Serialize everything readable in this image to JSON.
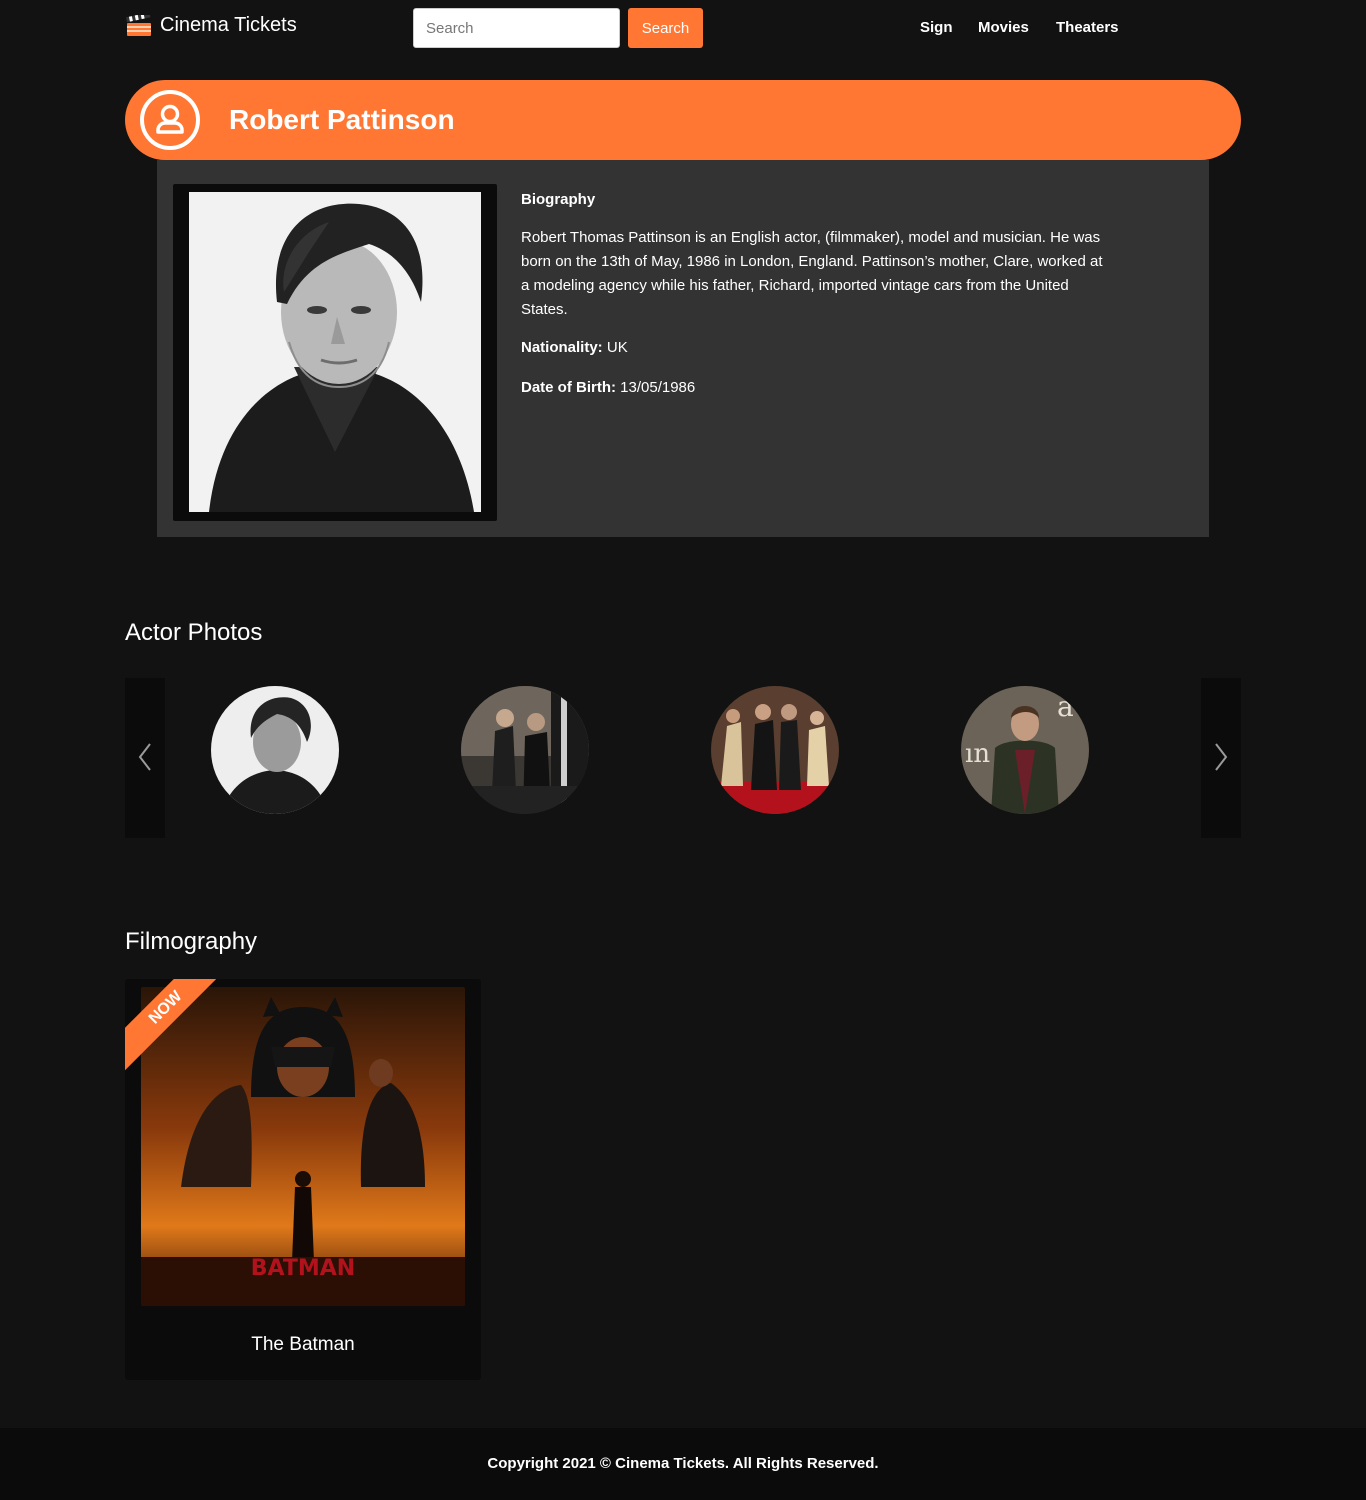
{
  "header": {
    "brand": "Cinema Tickets",
    "search_placeholder": "Search",
    "search_button": "Search",
    "nav": [
      "Sign",
      "Movies",
      "Theaters"
    ]
  },
  "actor": {
    "name": "Robert Pattinson",
    "biography_heading": "Biography",
    "biography": "Robert Thomas Pattinson is an English actor, (filmmaker), model and musician. He was born on the 13th of May, 1986 in London, England. Pattinson’s mother, Clare, worked at a modeling agency while his father, Richard, imported vintage cars from the United States.",
    "nationality_label": "Nationality:",
    "nationality": "UK",
    "dob_label": "Date of Birth:",
    "dob": "13/05/1986"
  },
  "photos": {
    "title": "Actor Photos",
    "count": 4
  },
  "filmography": {
    "title": "Filmography",
    "films": [
      {
        "title": "The Batman",
        "badge": "NOW"
      }
    ]
  },
  "footer": {
    "copyright": "Copyright 2021 © Cinema Tickets. All Rights Reserved."
  },
  "colors": {
    "accent": "#ff7733",
    "background": "#121212",
    "card": "#333333"
  }
}
